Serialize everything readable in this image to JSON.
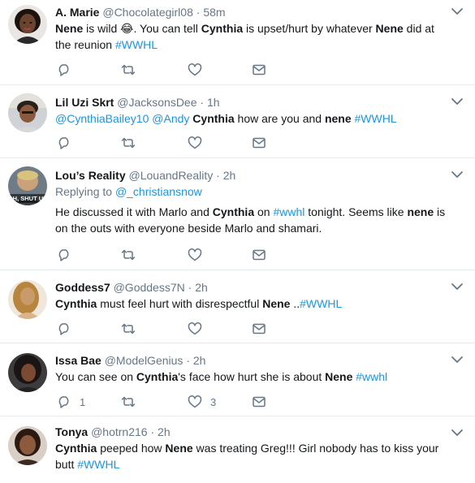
{
  "tweets": [
    {
      "name": "A. Marie",
      "handle": "@Chocolategirl08",
      "time": "58m",
      "segments": [
        {
          "t": "Nene",
          "b": true
        },
        {
          "t": " is wild 😂. You can tell "
        },
        {
          "t": "Cynthia",
          "b": true
        },
        {
          "t": " is upset/hurt by whatever "
        },
        {
          "t": "Nene",
          "b": true
        },
        {
          "t": " did at the reunion "
        },
        {
          "t": "#WWHL",
          "tag": true
        }
      ],
      "reply_count": "",
      "like_count": ""
    },
    {
      "name": "Lil Uzi Skrt",
      "handle": "@JacksonsDee",
      "time": "1h",
      "segments": [
        {
          "t": "@CynthiaBailey10",
          "tag": true
        },
        {
          "t": " "
        },
        {
          "t": "@Andy",
          "tag": true
        },
        {
          "t": " "
        },
        {
          "t": "Cynthia",
          "b": true
        },
        {
          "t": " how are you and "
        },
        {
          "t": "nene",
          "b": true
        },
        {
          "t": " "
        },
        {
          "t": "#WWHL",
          "tag": true
        }
      ],
      "reply_count": "",
      "like_count": ""
    },
    {
      "name": "Lou’s Reality",
      "handle": "@LouandReality",
      "time": "2h",
      "replying_prefix": "Replying to",
      "replying_to": "@_christiansnow",
      "avatar_caption": "OH, SHUT UP",
      "segments": [
        {
          "t": "He discussed it with Marlo and "
        },
        {
          "t": "Cynthia",
          "b": true
        },
        {
          "t": " on "
        },
        {
          "t": "#wwhl",
          "tag": true
        },
        {
          "t": " tonight. Seems like "
        },
        {
          "t": "nene",
          "b": true
        },
        {
          "t": " is on the outs with everyone beside Marlo and shamari."
        }
      ],
      "reply_count": "",
      "like_count": ""
    },
    {
      "name": "Goddess7",
      "handle": "@Goddess7N",
      "time": "2h",
      "segments": [
        {
          "t": "Cynthia",
          "b": true
        },
        {
          "t": " must feel hurt with disrespectful "
        },
        {
          "t": "Nene",
          "b": true
        },
        {
          "t": " .."
        },
        {
          "t": "#WWHL",
          "tag": true
        }
      ],
      "reply_count": "",
      "like_count": ""
    },
    {
      "name": "Issa Bae",
      "handle": "@ModelGenius",
      "time": "2h",
      "segments": [
        {
          "t": "You can see on "
        },
        {
          "t": "Cynthia",
          "b": true
        },
        {
          "t": "'s face how hurt she is about "
        },
        {
          "t": "Nene",
          "b": true
        },
        {
          "t": " "
        },
        {
          "t": "#wwhl",
          "tag": true
        }
      ],
      "reply_count": "1",
      "like_count": "3"
    },
    {
      "name": "Tonya",
      "handle": "@hotrn216",
      "time": "2h",
      "segments": [
        {
          "t": "Cynthia",
          "b": true
        },
        {
          "t": " peeped how "
        },
        {
          "t": "Nene",
          "b": true
        },
        {
          "t": " was treating Greg!!! Girl nobody has to kiss your butt "
        },
        {
          "t": "#WWHL",
          "tag": true
        }
      ],
      "reply_count": "",
      "like_count": ""
    }
  ],
  "separator": "·",
  "colors": {
    "link": "#1b95e0",
    "muted": "#657786",
    "text": "#14171a",
    "divider": "#e6ecf0"
  },
  "icons": {
    "reply": "reply-icon",
    "retweet": "retweet-icon",
    "like": "heart-icon",
    "message": "envelope-icon",
    "menu": "chevron-down-icon"
  }
}
